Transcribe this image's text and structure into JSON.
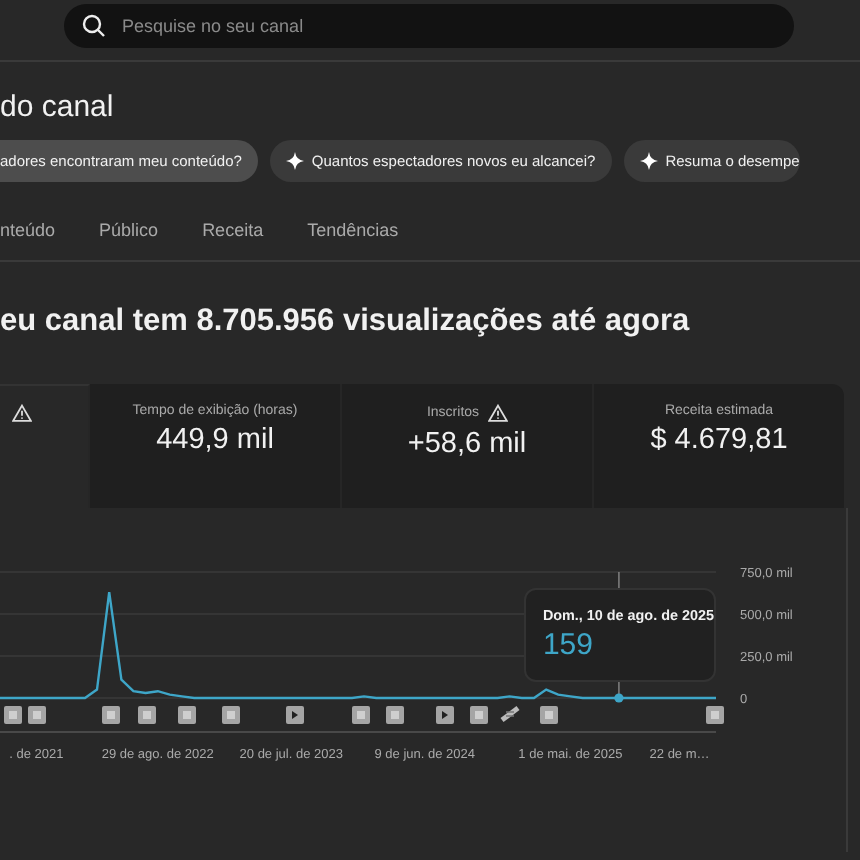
{
  "search": {
    "placeholder": "Pesquise no seu canal"
  },
  "page_title": "do canal",
  "suggestion_chips": [
    {
      "label": "adores encontraram meu conteúdo?",
      "sparkle": false,
      "selected": true
    },
    {
      "label": "Quantos espectadores novos eu alcancei?",
      "sparkle": true,
      "selected": false
    },
    {
      "label": "Resuma o desempe",
      "sparkle": true,
      "selected": false
    }
  ],
  "tabs": [
    {
      "label": "nteúdo",
      "selected": false
    },
    {
      "label": "Público",
      "selected": false
    },
    {
      "label": "Receita",
      "selected": false
    },
    {
      "label": "Tendências",
      "selected": false
    }
  ],
  "headline": "eu canal tem 8.705.956 visualizações até agora",
  "metrics": [
    {
      "warning": true,
      "selected": true
    },
    {
      "label": "Tempo de exibição (horas)",
      "value": "449,9 mil",
      "warning": false,
      "selected": false
    },
    {
      "label": "Inscritos",
      "value": "+58,6 mil",
      "warning": true,
      "selected": false
    },
    {
      "label": "Receita estimada",
      "value": "$ 4.679,81",
      "warning": false,
      "selected": false
    }
  ],
  "chart": {
    "chart_data": {
      "type": "line",
      "ylim": [
        0,
        750
      ],
      "yticks": [
        {
          "value": 0,
          "label": "0"
        },
        {
          "value": 250,
          "label": "250,0 mil"
        },
        {
          "value": 500,
          "label": "500,0 mil"
        },
        {
          "value": 750,
          "label": "750,0 mil"
        }
      ],
      "categories": [
        null,
        null,
        null,
        ". de 2021",
        null,
        null,
        null,
        null,
        null,
        null,
        null,
        null,
        null,
        "29 de ago. de 2022",
        null,
        null,
        null,
        null,
        null,
        null,
        null,
        null,
        null,
        null,
        "20 de jul. de 2023",
        null,
        null,
        null,
        null,
        null,
        null,
        null,
        null,
        null,
        null,
        "9 de jun. de 2024",
        null,
        null,
        null,
        null,
        null,
        null,
        null,
        null,
        null,
        null,
        null,
        "1 de mai. de 2025",
        null,
        null,
        null,
        null,
        null,
        null,
        null,
        null,
        "22 de m…",
        null,
        null,
        null
      ],
      "series": [
        {
          "color": "#3ea6c8",
          "values": [
            0,
            0,
            0,
            0,
            0,
            0,
            0,
            0,
            50,
            630,
            110,
            40,
            30,
            40,
            20,
            10,
            0,
            0,
            0,
            0,
            0,
            0,
            0,
            0,
            0,
            0,
            0,
            0,
            0,
            0,
            10,
            0,
            0,
            0,
            0,
            0,
            0,
            0,
            0,
            0,
            0,
            0,
            10,
            0,
            0,
            50,
            20,
            10,
            0,
            0,
            0,
            0,
            0,
            0,
            0,
            0,
            0,
            0,
            0,
            0
          ]
        }
      ]
    },
    "tooltip": {
      "date": "Dom., 10 de ago. de 2025",
      "value": "159"
    }
  }
}
